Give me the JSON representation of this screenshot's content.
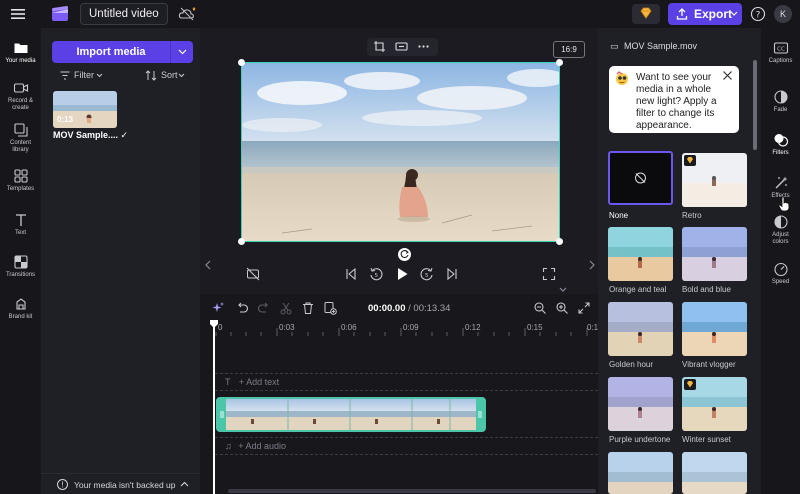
{
  "app": {
    "project_title": "Untitled video",
    "export_label": "Export",
    "avatar_initial": "K"
  },
  "left_rail": [
    {
      "label": "Your media",
      "icon": "folder-icon"
    },
    {
      "label": "Record &\ncreate",
      "icon": "camera-icon"
    },
    {
      "label": "Content\nlibrary",
      "icon": "library-icon"
    },
    {
      "label": "Templates",
      "icon": "templates-icon"
    },
    {
      "label": "Text",
      "icon": "text-icon"
    },
    {
      "label": "Transitions",
      "icon": "transitions-icon"
    },
    {
      "label": "Brand kit",
      "icon": "brand-icon"
    }
  ],
  "media_panel": {
    "import_label": "Import media",
    "filter_label": "Filter",
    "sort_label": "Sort",
    "media_items": [
      {
        "name": "MOV Sample....",
        "duration": "0:13"
      }
    ],
    "backup_text": "Your media isn't backed up"
  },
  "preview": {
    "aspect_ratio": "16:9"
  },
  "timeline": {
    "current_time": "00:00.00",
    "total_time": "/ 00:13.34",
    "ticks": [
      "0",
      "0:03",
      "0:06",
      "0:09",
      "0:12",
      "0:15",
      "0:18"
    ],
    "add_text": "+ Add text",
    "add_audio": "+ Add audio"
  },
  "properties": {
    "file_name": "MOV Sample.mov",
    "tip_text": "Want to see your media in a whole new light? Apply a filter to change its appearance.",
    "filters": [
      {
        "name": "None",
        "premium": false,
        "selected": true
      },
      {
        "name": "Retro",
        "premium": true,
        "selected": false
      },
      {
        "name": "Orange and teal",
        "premium": false,
        "selected": false
      },
      {
        "name": "Bold and blue",
        "premium": false,
        "selected": false
      },
      {
        "name": "Golden hour",
        "premium": false,
        "selected": false
      },
      {
        "name": "Vibrant vlogger",
        "premium": false,
        "selected": false
      },
      {
        "name": "Purple undertone",
        "premium": false,
        "selected": false
      },
      {
        "name": "Winter sunset",
        "premium": true,
        "selected": false
      }
    ]
  },
  "right_rail": [
    {
      "label": "Captions",
      "icon": "captions-icon"
    },
    {
      "label": "Fade",
      "icon": "fade-icon"
    },
    {
      "label": "Filters",
      "icon": "filters-icon"
    },
    {
      "label": "Effects",
      "icon": "effects-icon"
    },
    {
      "label": "Adjust\ncolors",
      "icon": "adjust-icon"
    },
    {
      "label": "Speed",
      "icon": "speed-icon"
    }
  ],
  "colors": {
    "accent": "#5b40e6",
    "selection": "#38d5b8",
    "background": "#1b1b21"
  }
}
